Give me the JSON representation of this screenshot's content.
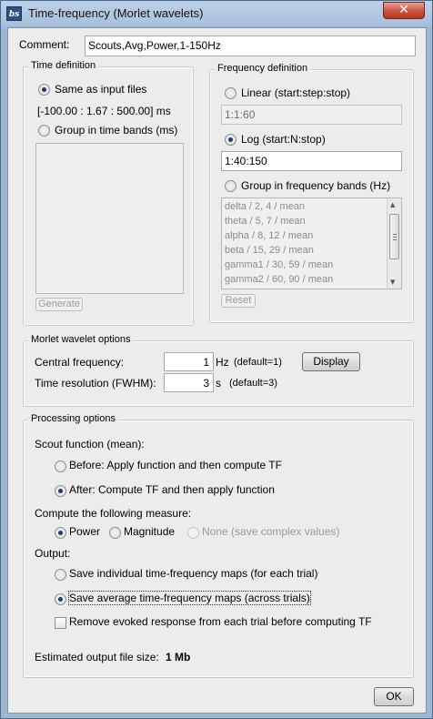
{
  "window": {
    "title": "Time-frequency (Morlet wavelets)",
    "app_icon_text": "bs",
    "close_glyph": "✕"
  },
  "comment": {
    "label": "Comment:",
    "value": "Scouts,Avg,Power,1-150Hz"
  },
  "time_definition": {
    "title": "Time definition",
    "same_as_input_label": "Same as input files",
    "same_as_input_checked": true,
    "time_range_text": "[-100.00 : 1.67 : 500.00] ms",
    "group_bands_label": "Group in time bands (ms)",
    "group_bands_checked": false,
    "generate_label": "Generate"
  },
  "frequency_definition": {
    "title": "Frequency definition",
    "linear_label": "Linear (start:step:stop)",
    "linear_checked": false,
    "linear_value": "1:1:60",
    "log_label": "Log (start:N:stop)",
    "log_checked": true,
    "log_value": "1:40:150",
    "group_bands_label": "Group in frequency bands (Hz)",
    "group_bands_checked": false,
    "bands": [
      "delta / 2, 4 / mean",
      "theta / 5, 7 / mean",
      "alpha / 8, 12 / mean",
      "beta / 15, 29 / mean",
      "gamma1 / 30, 59 / mean",
      "gamma2 / 60, 90 / mean"
    ],
    "reset_label": "Reset"
  },
  "morlet": {
    "title": "Morlet wavelet options",
    "central_freq_label": "Central frequency:",
    "central_freq_value": "1",
    "central_freq_unit": "Hz",
    "central_freq_default": "(default=1)",
    "display_label": "Display",
    "time_res_label": "Time resolution (FWHM):",
    "time_res_value": "3",
    "time_res_unit": "s",
    "time_res_default": "(default=3)"
  },
  "processing": {
    "title": "Processing options",
    "scout_function_label": "Scout function (mean):",
    "before_label": "Before: Apply function and then compute TF",
    "before_checked": false,
    "after_label": "After: Compute TF and then apply function",
    "after_checked": true,
    "measure_label": "Compute the following measure:",
    "power_label": "Power",
    "power_checked": true,
    "magnitude_label": "Magnitude",
    "magnitude_checked": false,
    "none_label": "None (save complex values)",
    "none_checked": false,
    "output_label": "Output:",
    "save_individual_label": "Save individual time-frequency maps (for each trial)",
    "save_individual_checked": false,
    "save_average_label": "Save average time-frequency maps (across trials)",
    "save_average_checked": true,
    "remove_evoked_label": "Remove evoked response from each trial before computing TF",
    "remove_evoked_checked": false,
    "file_size_label": "Estimated output file size:",
    "file_size_value": "1 Mb"
  },
  "footer": {
    "ok_label": "OK"
  }
}
